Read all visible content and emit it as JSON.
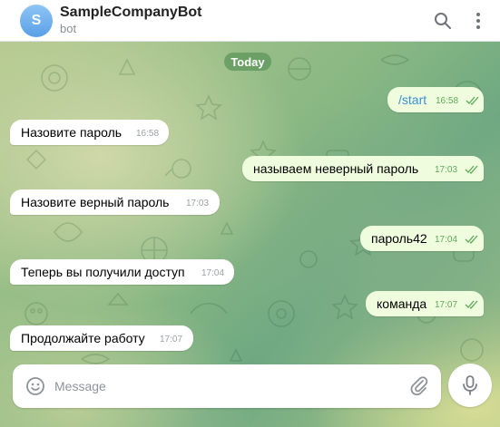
{
  "header": {
    "avatar_letter": "S",
    "title": "SampleCompanyBot",
    "subtitle": "bot",
    "search_icon": "search-icon",
    "menu_icon": "more-vertical-icon"
  },
  "chat": {
    "date_label": "Today",
    "messages": [
      {
        "direction": "out",
        "text": "/start",
        "time": "16:58",
        "read": true
      },
      {
        "direction": "in",
        "text": "Назовите пароль",
        "time": "16:58"
      },
      {
        "direction": "out",
        "text": "называем неверный пароль",
        "time": "17:03",
        "read": true
      },
      {
        "direction": "in",
        "text": "Назовите верный пароль",
        "time": "17:03"
      },
      {
        "direction": "out",
        "text": "пароль42",
        "time": "17:04",
        "read": true
      },
      {
        "direction": "in",
        "text": "Теперь вы получили доступ",
        "time": "17:04"
      },
      {
        "direction": "out",
        "text": "команда",
        "time": "17:07",
        "read": true
      },
      {
        "direction": "in",
        "text": "Продолжайте работу",
        "time": "17:07"
      }
    ]
  },
  "composer": {
    "placeholder": "Message",
    "value": "",
    "emoji_icon": "smiley-icon",
    "attach_icon": "paperclip-icon",
    "mic_icon": "microphone-icon"
  },
  "colors": {
    "accent": "#3a8fd6",
    "outgoing_bubble": "#effdde",
    "incoming_bubble": "#ffffff",
    "read_ticks": "#5daa5a",
    "date_pill": "#5c965a"
  }
}
